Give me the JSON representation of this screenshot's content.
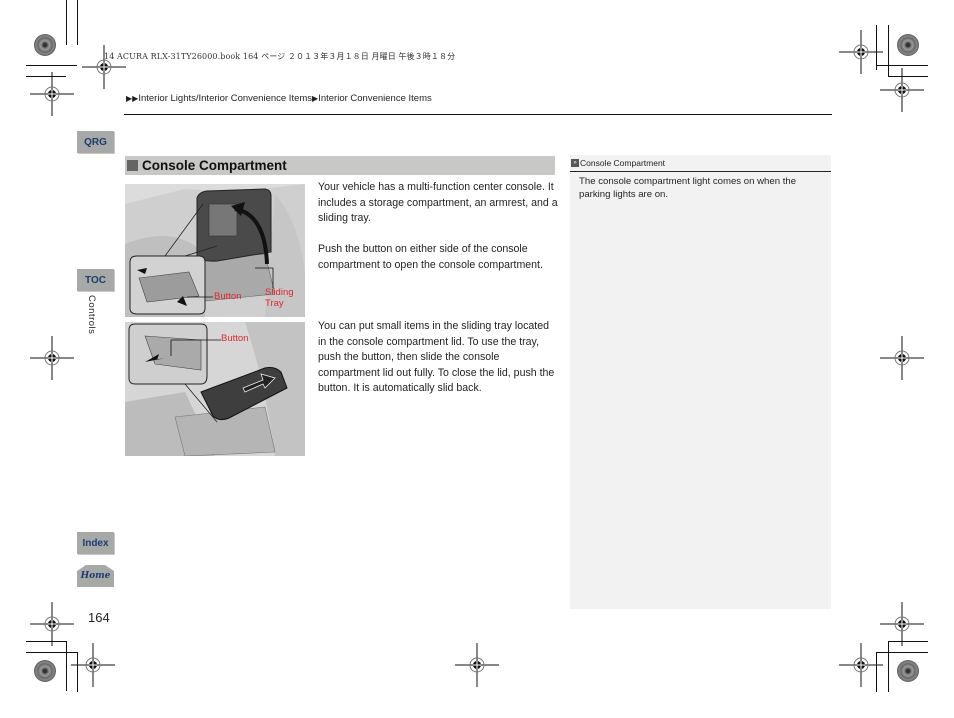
{
  "print_meta": {
    "header_line": "14 ACURA RLX-31TY26000.book  164 ページ  ２０１３年３月１８日  月曜日  午後３時１８分"
  },
  "breadcrumb": {
    "items": [
      "Interior Lights/Interior Convenience Items",
      "Interior Convenience Items"
    ]
  },
  "nav_tabs": {
    "qrg": "QRG",
    "toc": "TOC",
    "index": "Index",
    "home": "Home"
  },
  "chapter_label": "Controls",
  "page_number": "164",
  "section": {
    "title": "Console Compartment",
    "paragraphs": [
      "Your vehicle has a multi-function center console. It includes a storage compartment, an armrest, and a sliding tray.",
      "Push the button on either side of the console compartment to open the console compartment.",
      "You can put small items in the sliding tray located in the console compartment lid. To use the tray, push the button, then slide the console compartment lid out fully. To close the lid, push the button. It is automatically slid back."
    ],
    "figures": [
      {
        "labels": [
          "Button",
          "Sliding Tray"
        ]
      },
      {
        "labels": [
          "Button"
        ]
      }
    ]
  },
  "side_note": {
    "title": "Console Compartment",
    "text": "The console compartment light comes on when the parking lights are on."
  },
  "colors": {
    "tab_bg": "#a7a9a6",
    "tab_text": "#1b3c73",
    "section_bar": "#c8c9c7",
    "callout_red": "#e0262b",
    "side_panel_bg": "#f2f2f2"
  }
}
